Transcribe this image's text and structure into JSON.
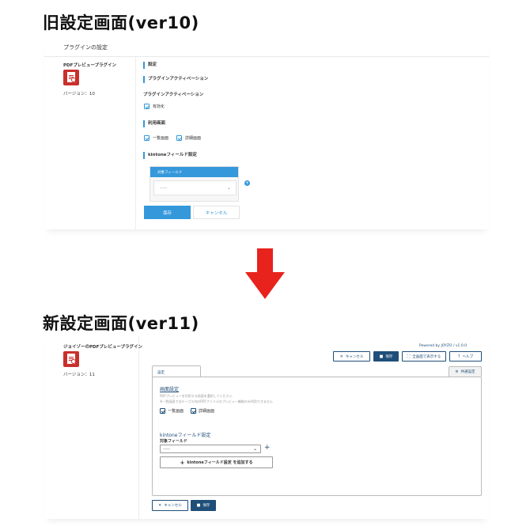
{
  "titles": {
    "old": "旧設定画面(ver10)",
    "new": "新設定画面(ver11)"
  },
  "old": {
    "header": "プラグインの設定",
    "plugin_name": "PDFプレビュープラグイン",
    "version": "バージョン：10",
    "sec_settings": "設定",
    "sec_activation": "プラグインアクティベーション",
    "activation_label": "プラグインアクティベーション",
    "enable_label": "有効化",
    "usage_screens": "利用画面",
    "list_view": "一覧画面",
    "detail_view": "詳細画面",
    "kintone_field_settings": "kintoneフィールド設定",
    "target_field_header": "対象フィールド",
    "select_value": "-----",
    "save": "保存",
    "cancel": "キャンセル"
  },
  "new": {
    "plugin_name": "ジョイゾーのPDFプレビュープラグイン",
    "version": "バージョン：11",
    "powered_by": "Powered by JOYZO / v1.0.0",
    "toolbar": {
      "cancel": "キャンセル",
      "save": "保存",
      "fullscreen": "全画面で表示する",
      "help": "ヘルプ"
    },
    "tabs": {
      "settings": "設定",
      "common": "共通設定"
    },
    "screen_settings": "画面設定",
    "desc1": "PDFプレビューを利用する画面を選択してください",
    "desc2": "※一覧画面ではテーブル内のPDFファイルのプレビュー機能のみ利用できません",
    "list_view": "一覧画面",
    "detail_view": "詳細画面",
    "kintone_field_settings": "kintoneフィールド設定",
    "target_field": "対象フィールド",
    "select_value": "-----",
    "add_field": "kintoneフィールド設定 を追加する",
    "bottom_cancel": "キャンセル",
    "bottom_save": "保存"
  }
}
